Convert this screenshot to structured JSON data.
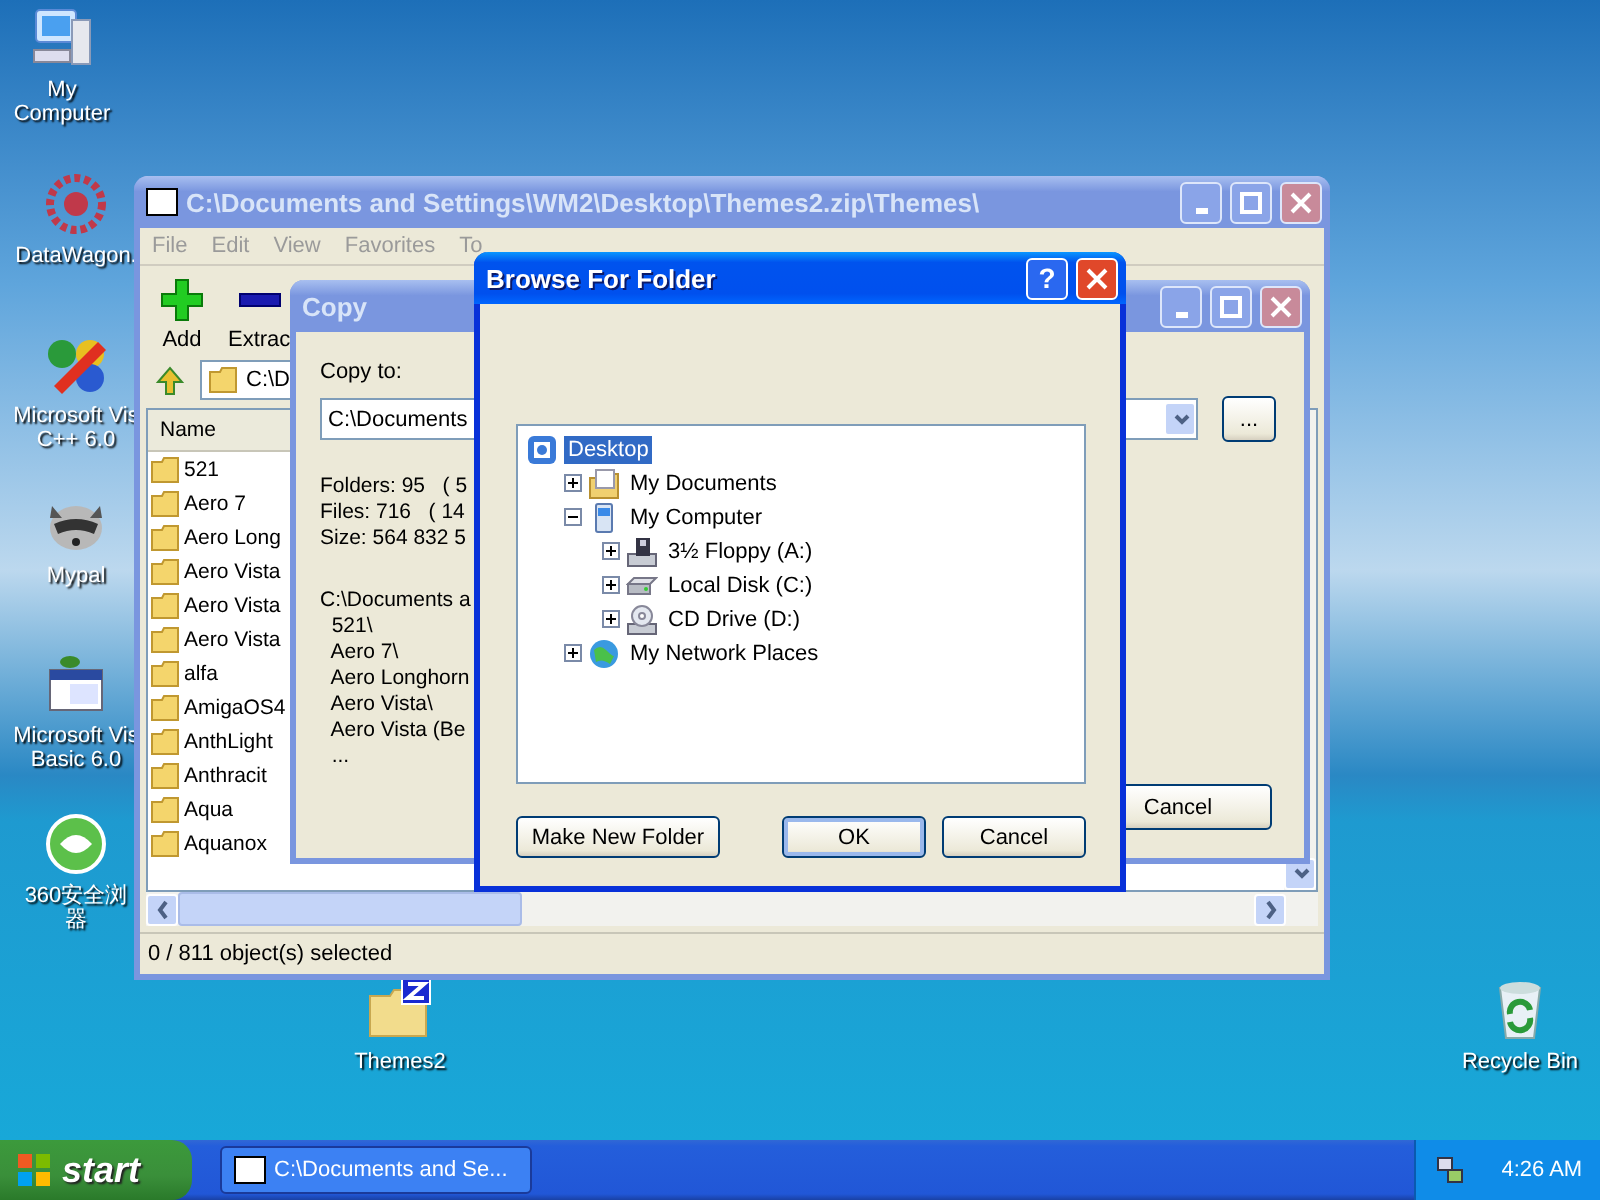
{
  "desktop_icons": [
    {
      "kind": "computer",
      "label": "My Computer"
    },
    {
      "kind": "flower",
      "label": "DataWagon."
    },
    {
      "kind": "vcpp",
      "label": "Microsoft Vis\nC++ 6.0"
    },
    {
      "kind": "raccoon",
      "label": "Mypal"
    },
    {
      "kind": "vb",
      "label": "Microsoft Vis\nBasic 6.0"
    },
    {
      "kind": "globe",
      "label": "360安全浏器"
    },
    {
      "kind": "zip",
      "label": "Themes2"
    },
    {
      "kind": "recycle",
      "label": "Recycle Bin"
    }
  ],
  "main_window": {
    "title": "C:\\Documents and Settings\\WM2\\Desktop\\Themes2.zip\\Themes\\",
    "active": false,
    "menu": [
      "File",
      "Edit",
      "View",
      "Favorites",
      "To"
    ],
    "toolbar": [
      {
        "kind": "add",
        "label": "Add"
      },
      {
        "kind": "extract",
        "label": "Extrac"
      }
    ],
    "address": "C:\\D",
    "column": "Name",
    "files": [
      "521",
      "Aero 7",
      "Aero Long",
      "Aero Vista",
      "Aero Vista",
      "Aero Vista",
      "alfa",
      "AmigaOS4",
      "AnthLight",
      "Anthracit",
      "Aqua",
      "Aquanox"
    ],
    "status": "0 / 811 object(s) selected"
  },
  "copy_dialog": {
    "title": "Copy",
    "active": false,
    "label": "Copy to:",
    "path": "C:\\Documents",
    "browse_button": "...",
    "stats": [
      "Folders: 95   ( 5",
      "Files: 716   ( 14",
      "Size: 564 832 5"
    ],
    "listing": [
      "C:\\Documents a",
      "  521\\",
      "  Aero 7\\",
      "  Aero Longhorn",
      "  Aero Vista\\",
      "  Aero Vista (Be",
      "  ..."
    ],
    "cancel": "Cancel"
  },
  "browse_dialog": {
    "title": "Browse For Folder",
    "active": true,
    "help": "?",
    "tree": [
      {
        "kind": "desktop",
        "label": "Desktop",
        "selected": true,
        "children": [
          {
            "kind": "documents",
            "label": "My Documents",
            "selected": false,
            "expanded": false
          },
          {
            "kind": "computer",
            "label": "My Computer",
            "selected": false,
            "expanded": true,
            "children": [
              {
                "kind": "floppy",
                "label": "3½ Floppy (A:)",
                "selected": false,
                "expanded": false
              },
              {
                "kind": "disk",
                "label": "Local Disk (C:)",
                "selected": false,
                "expanded": false
              },
              {
                "kind": "cd",
                "label": "CD Drive (D:)",
                "selected": false,
                "expanded": false
              }
            ]
          },
          {
            "kind": "network",
            "label": "My Network Places",
            "selected": false,
            "expanded": false
          }
        ]
      }
    ],
    "buttons": [
      {
        "label": "Make New Folder",
        "default": false
      },
      {
        "label": "OK",
        "default": true
      },
      {
        "label": "Cancel",
        "default": false
      }
    ]
  },
  "taskbar": {
    "start": "start",
    "tasks": [
      {
        "label": "C:\\Documents and Se...",
        "selected": false
      }
    ],
    "clock": "4:26 AM"
  }
}
